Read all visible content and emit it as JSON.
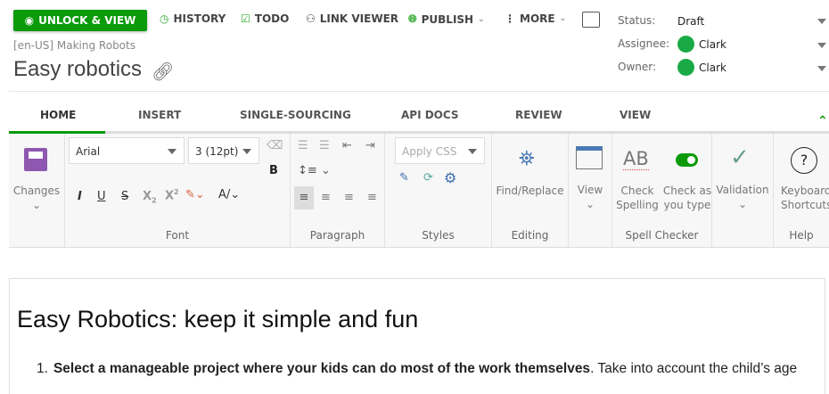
{
  "toolbar": {
    "unlock": "UNLOCK & VIEW",
    "history": "HISTORY",
    "todo": "TODO",
    "link_viewer": "LINK VIEWER",
    "publish": "PUBLISH",
    "more": "MORE"
  },
  "breadcrumb": "[en-US] Making Robots",
  "title": "Easy robotics",
  "meta": {
    "status_label": "Status:",
    "status": "Draft",
    "assignee_label": "Assignee:",
    "assignee": "Clark",
    "owner_label": "Owner:",
    "owner": "Clark"
  },
  "tabs": [
    "HOME",
    "INSERT",
    "SINGLE-SOURCING",
    "API DOCS",
    "REVIEW",
    "VIEW"
  ],
  "ribbon": {
    "changes": "Changes",
    "font_name": "Arial",
    "font_size": "3 (12pt)",
    "font_group": "Font",
    "paragraph_group": "Paragraph",
    "css": "Apply CSS",
    "styles_group": "Styles",
    "find_replace": "Find/Replace",
    "editing_group": "Editing",
    "view": "View",
    "check_spelling_1": "Check",
    "check_spelling_2": "Spelling",
    "check_type_1": "Check as",
    "check_type_2": "you type",
    "spell_group": "Spell Checker",
    "validation": "Validation",
    "kb_1": "Keyboard",
    "kb_2": "Shortcuts",
    "help_group": "Help"
  },
  "doc": {
    "heading": "Easy Robotics: keep it simple and fun",
    "item_number": "1.",
    "item_bold": "Select a manageable project where your kids can do most of the work themselves",
    "item_rest": ". Take into account the child’s age"
  },
  "colors": {
    "accent": "#0a9a0a"
  }
}
